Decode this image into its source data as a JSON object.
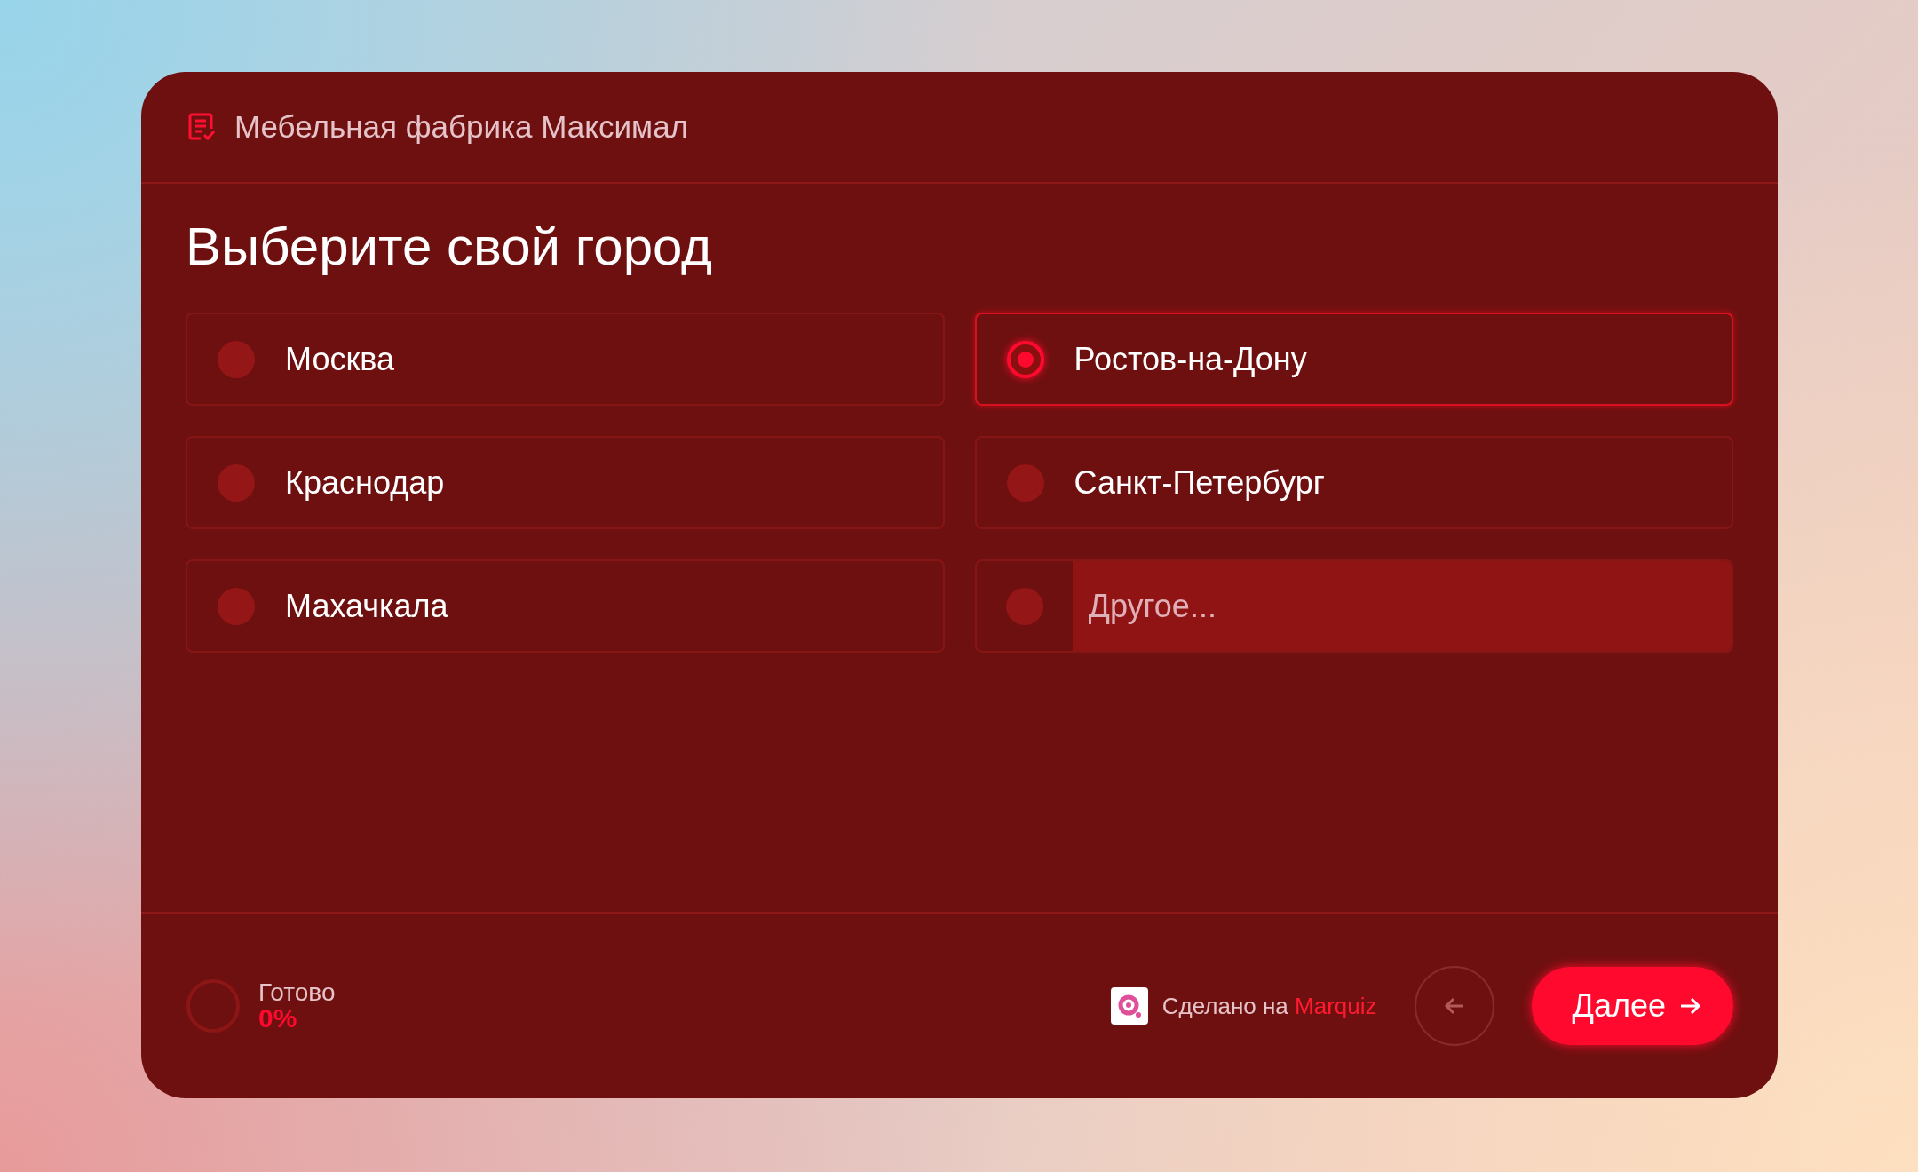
{
  "header": {
    "title": "Мебельная фабрика Максимал"
  },
  "question": {
    "title": "Выберите свой город"
  },
  "options": [
    {
      "kind": "radio",
      "label": "Москва",
      "selected": false
    },
    {
      "kind": "radio",
      "label": "Ростов-на-Дону",
      "selected": true
    },
    {
      "kind": "radio",
      "label": "Краснодар",
      "selected": false
    },
    {
      "kind": "radio",
      "label": "Санкт-Петербург",
      "selected": false
    },
    {
      "kind": "radio",
      "label": "Махачкала",
      "selected": false
    },
    {
      "kind": "other",
      "placeholder": "Другое...",
      "selected": false
    }
  ],
  "footer": {
    "progress_label": "Готово",
    "progress_value": "0%",
    "level": 0,
    "made_with": "Сделано на",
    "brand": "Marquiz",
    "next_button": "Далее"
  }
}
